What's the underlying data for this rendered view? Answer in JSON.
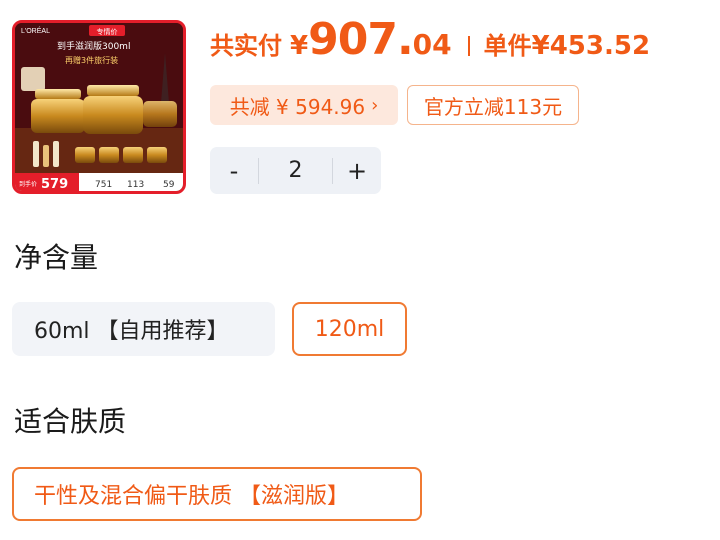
{
  "product_image": {
    "brand": "L'ORÉAL",
    "promo_tag": "专情价",
    "headline": "到手滋润版300ml",
    "subline": "再赠3件旅行装",
    "price_marks": [
      {
        "label": "到手价",
        "value": "579"
      },
      {
        "label": "",
        "value": "751"
      },
      {
        "label": "",
        "value": "113"
      },
      {
        "label": "",
        "value": "59"
      }
    ]
  },
  "price": {
    "total_label": "共实付",
    "currency": "¥",
    "total_int": "907.",
    "total_dec": "04",
    "unit_label": "单件",
    "unit_price": "¥453.52"
  },
  "chips": {
    "discount": "共减 ¥ 594.96",
    "discount_chevron": "›",
    "official": "官方立减113元"
  },
  "stepper": {
    "minus": "-",
    "quantity": "2",
    "plus": "+"
  },
  "sections": {
    "volume": {
      "title": "净含量",
      "options": [
        {
          "label": "60ml 【自用推荐】",
          "selected": false
        },
        {
          "label": "120ml",
          "selected": true
        }
      ]
    },
    "skin": {
      "title": "适合肤质",
      "options": [
        {
          "label": "干性及混合偏干肤质 【滋润版】",
          "selected": true
        }
      ]
    }
  },
  "colors": {
    "accent": "#f05a16",
    "chip_bg": "#fde8dd",
    "stepper_bg": "#eef1f6",
    "option_bg": "#f2f4f8"
  }
}
